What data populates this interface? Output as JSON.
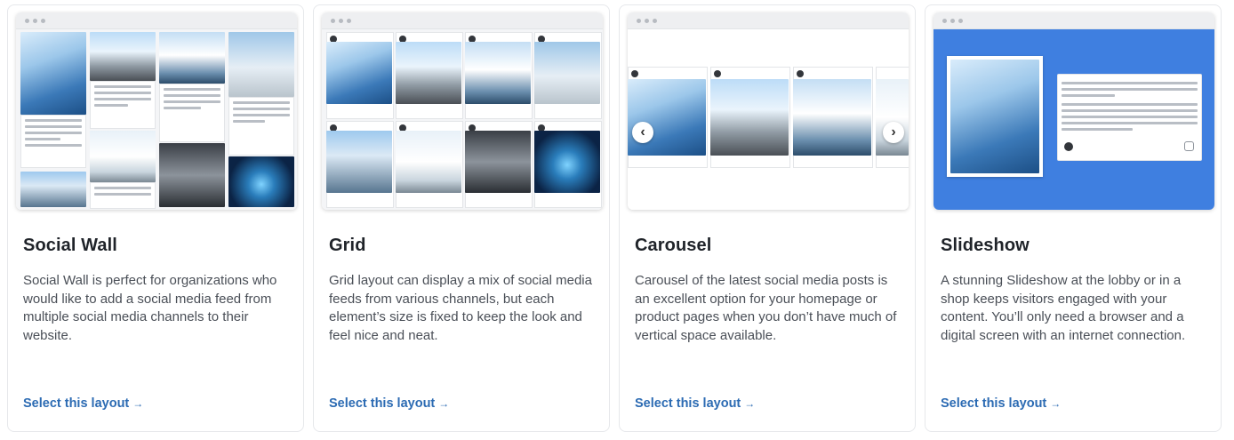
{
  "cards": [
    {
      "title": "Social Wall",
      "description": "Social Wall is perfect for organizations who would like to add a social media feed from multiple social media channels to their website.",
      "cta": "Select this layout"
    },
    {
      "title": "Grid",
      "description": "Grid layout can display a mix of social media feeds from various channels, but each element’s size is fixed to keep the look and feel nice and neat.",
      "cta": "Select this layout"
    },
    {
      "title": "Carousel",
      "description": "Carousel of the latest social media posts is an excellent option for your homepage or product pages when you don’t have much of vertical space available.",
      "cta": "Select this layout"
    },
    {
      "title": "Slideshow",
      "description": "A stunning Slideshow at the lobby or in a shop keeps visitors engaged with your content. You’ll only need a browser and a digital screen with an internet connection.",
      "cta": "Select this layout"
    }
  ],
  "cta_arrow": "→",
  "carousel_nav": {
    "prev": "‹",
    "next": "›"
  },
  "colors": {
    "link": "#2c6bb3",
    "slideshow_bg": "#3f7fe0",
    "title": "#1f2329"
  }
}
